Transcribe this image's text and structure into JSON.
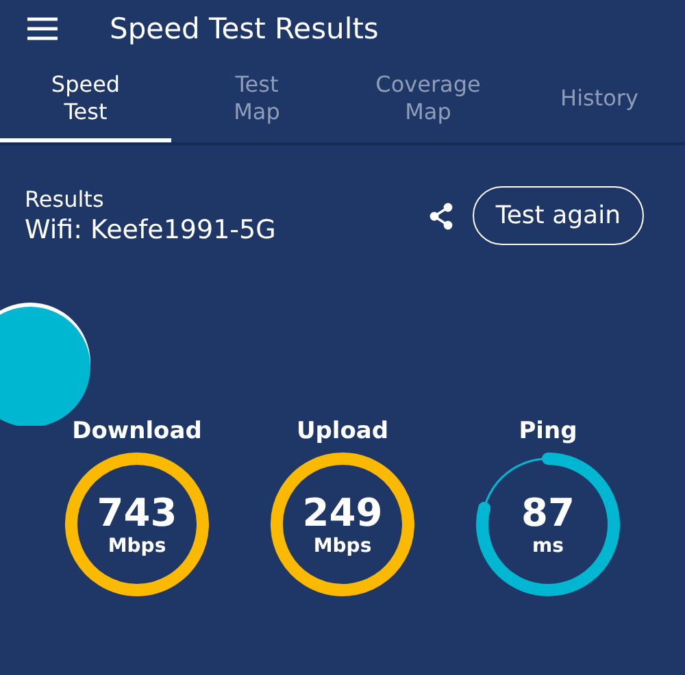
{
  "app_bar": {
    "title": "Speed Test Results"
  },
  "tabs": [
    {
      "label": "Speed\nTest",
      "selected": true
    },
    {
      "label": "Test\nMap",
      "selected": false
    },
    {
      "label": "Coverage\nMap",
      "selected": false
    },
    {
      "label": "History",
      "selected": false
    }
  ],
  "results": {
    "heading": "Results",
    "network": "Wifi: Keefe1991-5G",
    "button": "Test again"
  },
  "gauges": [
    {
      "label": "Download",
      "value": "743",
      "unit": "Mbps",
      "kind": "full",
      "color": "#fbb900"
    },
    {
      "label": "Upload",
      "value": "249",
      "unit": "Mbps",
      "kind": "full",
      "color": "#fbb900"
    },
    {
      "label": "Ping",
      "value": "87",
      "unit": "ms",
      "kind": "partial",
      "color": "#00b7d2"
    }
  ]
}
